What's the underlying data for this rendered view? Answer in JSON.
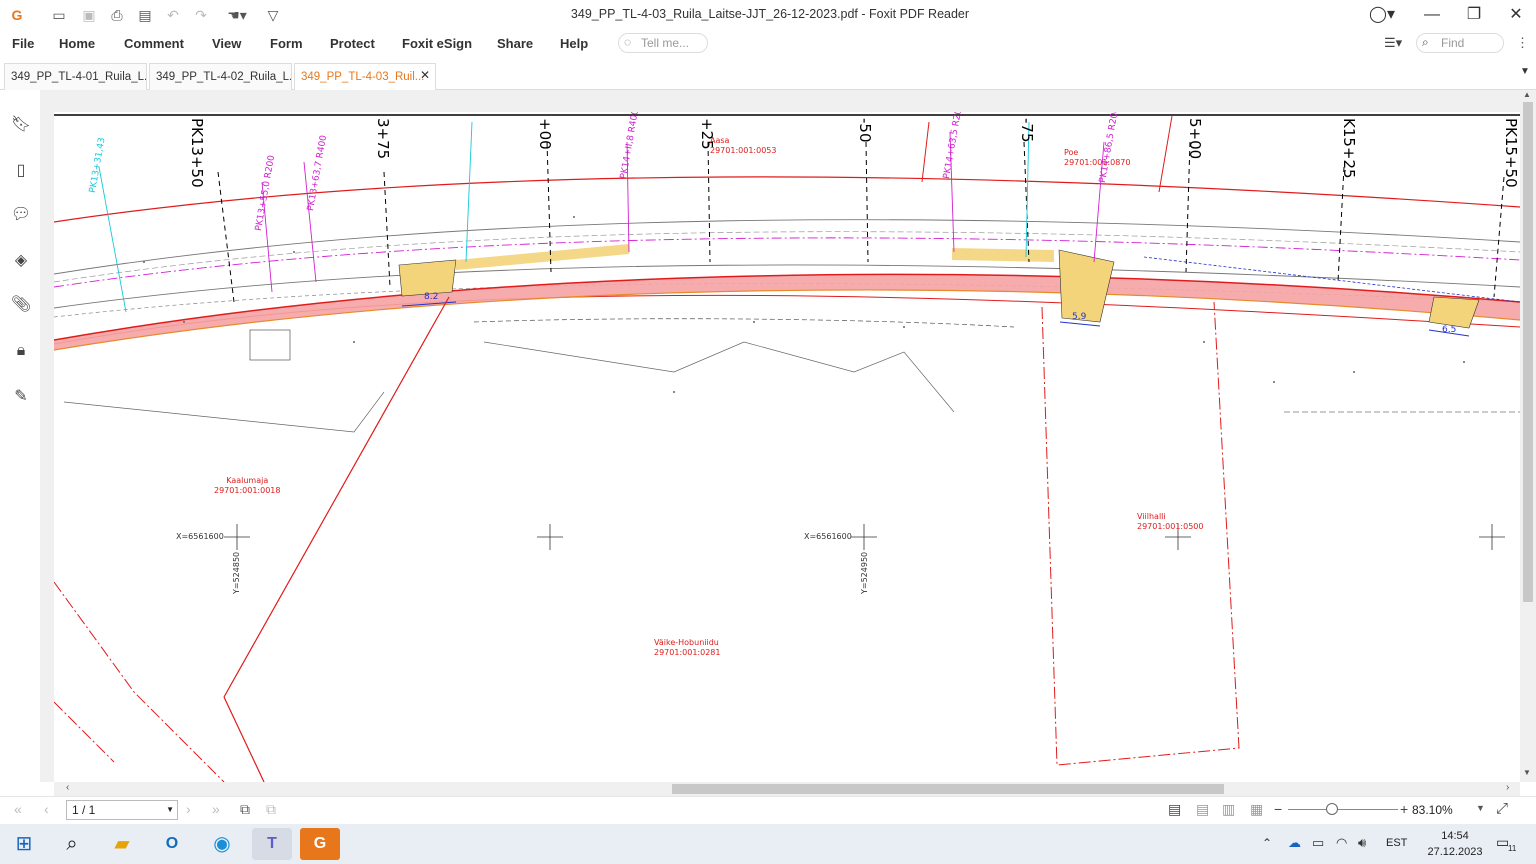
{
  "window": {
    "title": "349_PP_TL-4-03_Ruila_Laitse-JJT_26-12-2023.pdf - Foxit PDF Reader"
  },
  "menu": {
    "items": [
      "File",
      "Home",
      "Comment",
      "View",
      "Form",
      "Protect",
      "Foxit eSign",
      "Share",
      "Help"
    ],
    "tell_me_placeholder": "Tell me...",
    "find_placeholder": "Find"
  },
  "tabs": [
    {
      "label": "349_PP_TL-4-01_Ruila_L..."
    },
    {
      "label": "349_PP_TL-4-02_Ruila_L..."
    },
    {
      "label": "349_PP_TL-4-03_Ruil..."
    }
  ],
  "drawing": {
    "stations": [
      "PK13+50",
      "3+75",
      "+00",
      "+25",
      "-50",
      "-75",
      "5+00",
      "K15+25",
      "PK15+50"
    ],
    "curve_labels": [
      "PK13+31,43",
      "PK13+55,0 R200",
      "PK13+63,7 R400",
      "PK14+II,8 R400",
      "PK14+63,5 R200",
      "PK14+86,5 R200"
    ],
    "dims": [
      "8.2",
      "5.9",
      "6.5"
    ],
    "parcels": [
      {
        "name": "Aasa",
        "code": "29701:001:0053"
      },
      {
        "name": "Poe",
        "code": "29701:001:0870"
      },
      {
        "name": "Kaalumaja",
        "code": "29701:001:0018"
      },
      {
        "name": "Väike-Hobuniidu",
        "code": "29701:001:0281"
      },
      {
        "name": "Viilhalli",
        "code": "29701:001:0500"
      }
    ],
    "grid_x1": "X=6561600",
    "grid_x2": "X=6561600",
    "grid_y1": "Y=524850",
    "grid_y2": "Y=524950"
  },
  "status": {
    "page": "1 / 1",
    "zoom": "83.10%"
  },
  "taskbar": {
    "lang": "EST",
    "time": "14:54",
    "date": "27.12.2023",
    "notifications": "11"
  },
  "colors": {
    "accent": "#e8771b",
    "road_red": "#e01b1b",
    "magenta": "#d21fd2",
    "cyan": "#18c9d9",
    "road_fill": "#f5a3a3",
    "yellow_fill": "#f4d47a"
  }
}
